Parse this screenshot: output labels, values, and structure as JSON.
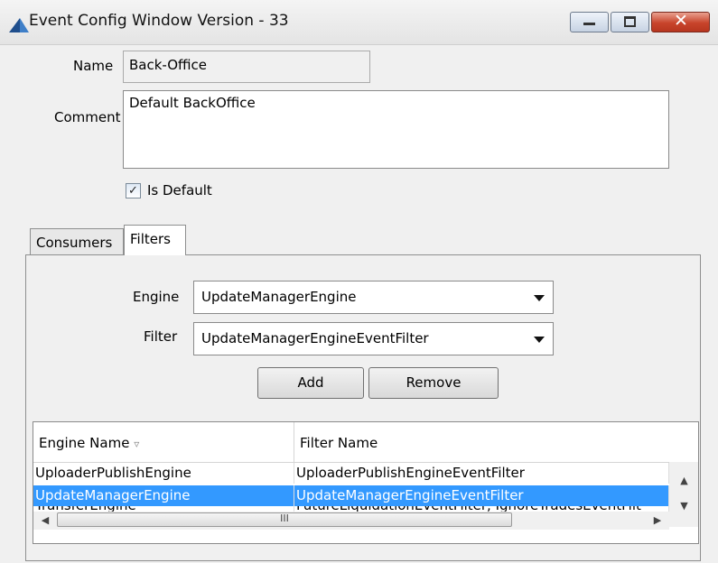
{
  "window": {
    "title": "Event Config Window  Version - 33",
    "controls": {
      "minimize_icon": "minimize-icon",
      "maximize_icon": "maximize-icon",
      "close_icon": "close-icon"
    }
  },
  "form": {
    "name_label": "Name",
    "name_value": "Back-Office",
    "comment_label": "Comment",
    "comment_value": "Default BackOffice",
    "is_default_label": "Is Default",
    "is_default_checked": true
  },
  "tabs": [
    {
      "label": "Consumers",
      "active": false
    },
    {
      "label": "Filters",
      "active": true
    }
  ],
  "filters": {
    "engine_label": "Engine",
    "engine_value": "UpdateManagerEngine",
    "filter_label": "Filter",
    "filter_value": "UpdateManagerEngineEventFilter",
    "add_label": "Add",
    "remove_label": "Remove"
  },
  "table": {
    "columns": [
      "Engine Name",
      "Filter Name"
    ],
    "sort_indicator": "▿",
    "rows": [
      {
        "engine": "UploaderPublishEngine",
        "filter": "UploaderPublishEngineEventFilter",
        "selected": false
      },
      {
        "engine": "UpdateManagerEngine",
        "filter": "UpdateManagerEngineEventFilter",
        "selected": true
      },
      {
        "engine": "TransferEngine",
        "filter": "FutureLiquidationEventFilter, IgnoreTradesEventFilt",
        "selected": false
      }
    ],
    "hscroll_grip": "III"
  },
  "colors": {
    "selection": "#3399ff",
    "close_button": "#c8442b"
  }
}
